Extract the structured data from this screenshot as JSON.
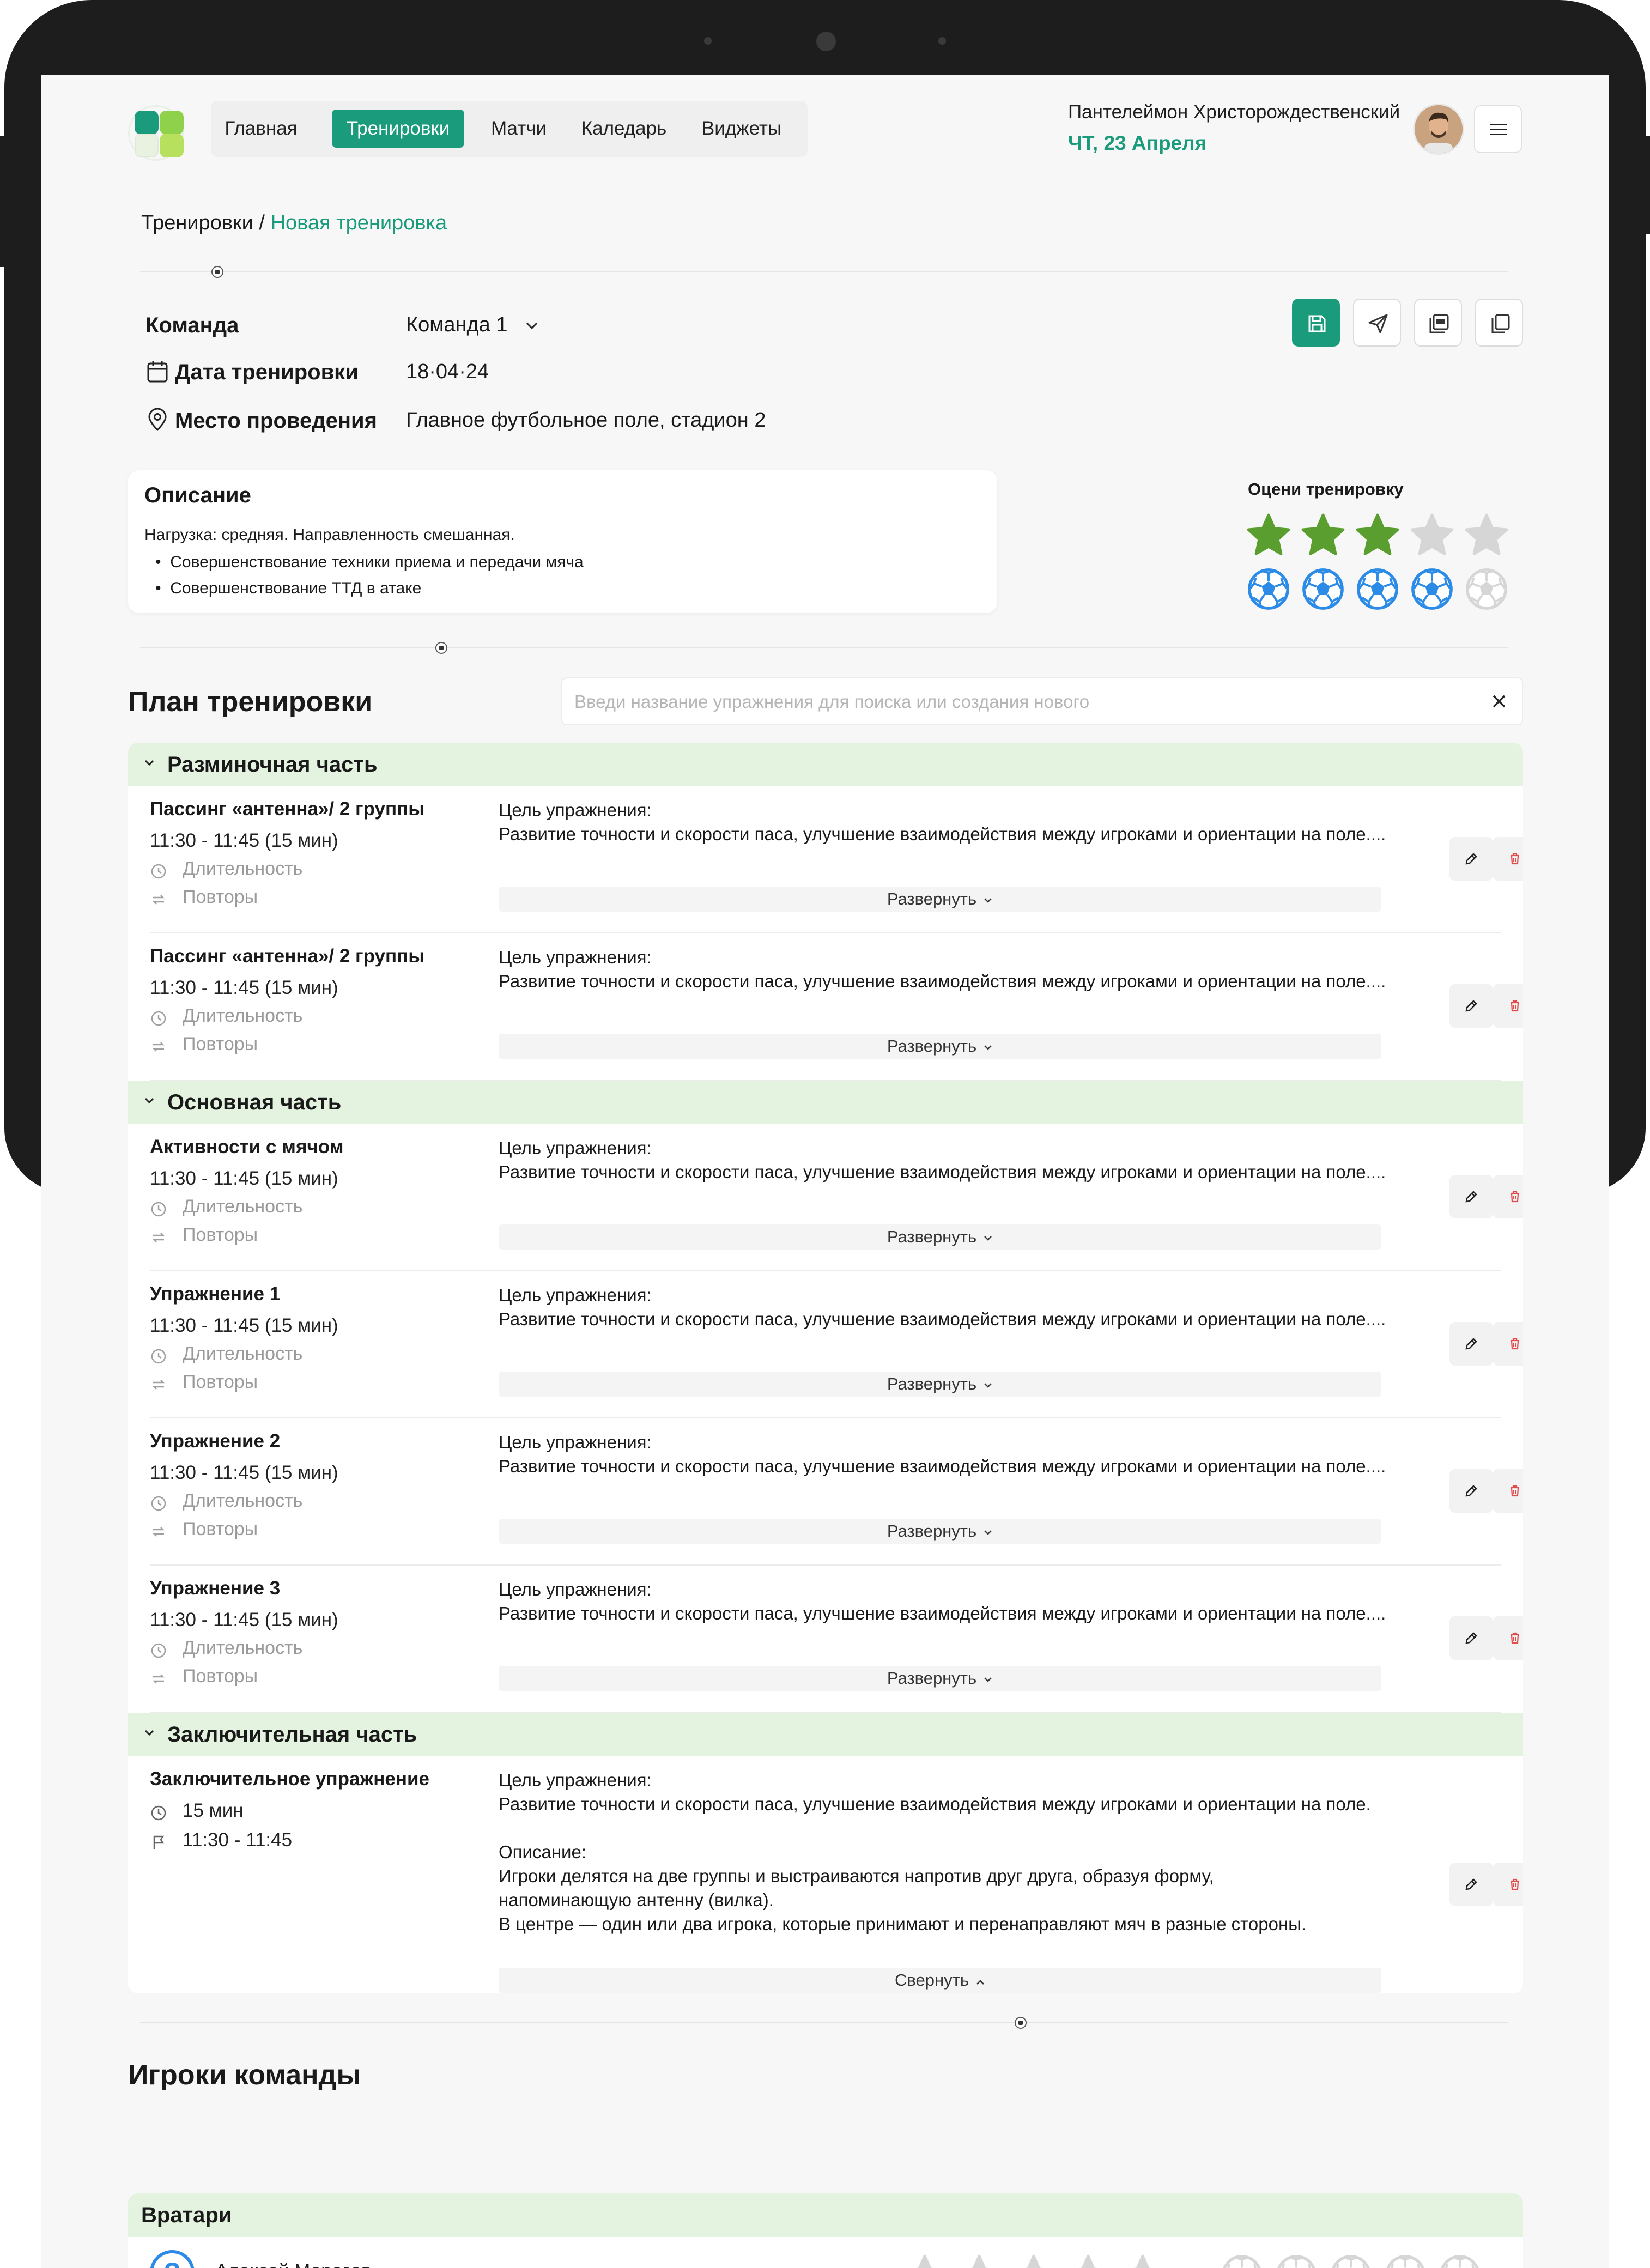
{
  "nav": {
    "items": [
      {
        "label": "Главная",
        "active": false
      },
      {
        "label": "Тренировки",
        "active": true
      },
      {
        "label": "Матчи",
        "active": false
      },
      {
        "label": "Каледарь",
        "active": false
      },
      {
        "label": "Виджеты",
        "active": false
      }
    ]
  },
  "user": {
    "name": "Пантелеймон Христорождественский",
    "date": "ЧТ, 23 Апреля"
  },
  "breadcrumb": {
    "parent": "Тренировки",
    "separator": " / ",
    "current": "Новая тренировка"
  },
  "form": {
    "team_label": "Команда",
    "team_value": "Команда 1",
    "date_label": "Дата тренировки",
    "date_value": "18·04·24",
    "place_label": "Место проведения",
    "place_value": "Главное футбольное поле, стадион 2"
  },
  "description": {
    "title": "Описание",
    "line": "Нагрузка: средняя. Направленность смешанная.",
    "bullets": [
      "Совершенствование техники приема и передачи мяча",
      "Совершенствование ТТД в атаке"
    ]
  },
  "rating": {
    "title": "Оцени тренировку",
    "stars": 3,
    "stars_max": 5,
    "balls": 4,
    "balls_max": 5
  },
  "plan": {
    "title": "План тренировки",
    "search_placeholder": "Введи название упражнения для поиска или создания нового",
    "expand_label": "Развернуть",
    "collapse_label": "Свернуть",
    "duration_label": "Длительность",
    "repeats_label": "Повторы",
    "goal_label": "Цель упражнения:",
    "goal_text": "Развитие точности и скорости паса, улучшение взаимодействия между игроками и ориентации на поле....",
    "sections": [
      {
        "title": "Разминочная часть",
        "exercises": [
          {
            "name": "Пассинг «антенна»/ 2 группы",
            "time": "11:30 - 11:45",
            "duration": "(15 мин)"
          },
          {
            "name": "Пассинг «антенна»/ 2 группы",
            "time": "11:30 - 11:45",
            "duration": "(15 мин)"
          }
        ]
      },
      {
        "title": "Основная часть",
        "exercises": [
          {
            "name": "Активности с мячом",
            "time": "11:30 - 11:45",
            "duration": "(15 мин)"
          },
          {
            "name": "Упражнение 1",
            "time": "11:30 - 11:45",
            "duration": "(15 мин)"
          },
          {
            "name": "Упражнение 2",
            "time": "11:30 - 11:45",
            "duration": "(15 мин)"
          },
          {
            "name": "Упражнение 3",
            "time": "11:30 - 11:45",
            "duration": "(15 мин)"
          }
        ]
      },
      {
        "title": "Заключительная часть",
        "exercises": []
      }
    ],
    "final_exercise": {
      "name": "Заключительное упражнение",
      "duration": "15 мин",
      "time": "11:30 - 11:45",
      "goal_text": "Развитие точности и скорости паса, улучшение взаимодействия между игроками и ориентации на поле.",
      "desc_label": "Описание:",
      "desc_line1": "Игроки делятся на две группы и выстраиваются напротив друг друга, образуя форму,",
      "desc_line2": "напоминающую антенну (вилка).",
      "desc_line3": "В центре — один или два игрока, которые принимают и перенаправляют мяч в разные стороны."
    }
  },
  "players": {
    "title": "Игроки команды",
    "groups": [
      {
        "title": "Вратари",
        "players": [
          {
            "name": "Алексей Морозов",
            "icon": "question-icon",
            "stars": 0,
            "balls": 0
          }
        ]
      }
    ]
  },
  "colors": {
    "accent": "#1a9b7b",
    "section_bg": "#e4f3e0",
    "star_active": "#5a9e2f",
    "ball_active": "#2b8be6",
    "inactive": "#d6d6d6",
    "delete": "#e14b4b"
  }
}
